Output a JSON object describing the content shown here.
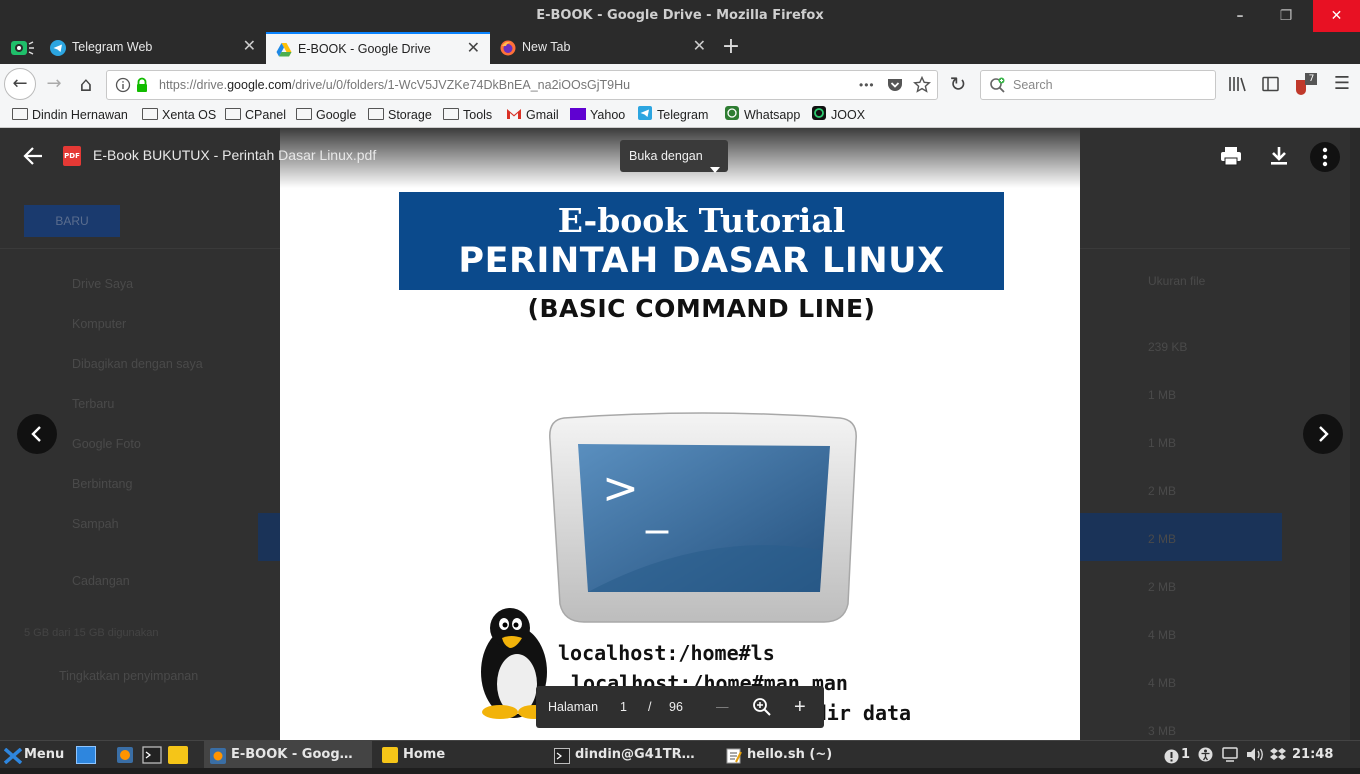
{
  "window": {
    "title": "E-BOOK - Google Drive - Mozilla Firefox",
    "minimize": "–",
    "maximize": "❐",
    "close": "✕"
  },
  "tabs": [
    {
      "label": "Telegram Web",
      "icon": "telegram-icon"
    },
    {
      "label": "E-BOOK - Google Drive",
      "icon": "google-drive-icon",
      "active": true
    },
    {
      "label": "New Tab",
      "icon": "firefox-icon"
    }
  ],
  "tab_close": "✕",
  "new_tab": "+",
  "nav": {
    "back": "←",
    "forward": "→",
    "home": "⌂",
    "url_prefix": "https://drive.",
    "url_domain": "google.com",
    "url_suffix": "/drive/u/0/folders/1-WcV5JVZKe74DkBnEA_na2iOOsGjT9Hu",
    "page_actions": "•••",
    "reload": "↻",
    "search_placeholder": "Search",
    "menu": "☰",
    "addon_badge": "7"
  },
  "bookmarks": [
    {
      "label": "Dindin Hernawan",
      "icon": "folder-icon"
    },
    {
      "label": "Xenta OS",
      "icon": "folder-icon"
    },
    {
      "label": "CPanel",
      "icon": "folder-icon"
    },
    {
      "label": "Google",
      "icon": "folder-icon"
    },
    {
      "label": "Storage",
      "icon": "folder-icon"
    },
    {
      "label": "Tools",
      "icon": "folder-icon"
    },
    {
      "label": "Gmail",
      "icon": "gmail-icon"
    },
    {
      "label": "Yahoo",
      "icon": "yahoo-icon"
    },
    {
      "label": "Telegram",
      "icon": "telegram-icon"
    },
    {
      "label": "Whatsapp",
      "icon": "whatsapp-icon"
    },
    {
      "label": "JOOX",
      "icon": "joox-icon"
    }
  ],
  "drive": {
    "new_button": "BARU",
    "sidebar": [
      "Drive Saya",
      "Komputer",
      "Dibagikan dengan saya",
      "Terbaru",
      "Google Foto",
      "Berbintang",
      "Sampah",
      "Cadangan"
    ],
    "storage_text": "5 GB dari 15 GB digunakan",
    "upgrade": "Tingkatkan penyimpanan",
    "size_header": "Ukuran file",
    "sizes": [
      "239 KB",
      "1 MB",
      "1 MB",
      "2 MB",
      "2 MB",
      "2 MB",
      "4 MB",
      "4 MB",
      "3 MB"
    ]
  },
  "viewer": {
    "file_name": "E-Book BUKUTUX - Perintah Dasar Linux.pdf",
    "file_badge": "PDF",
    "open_with": "Buka dengan",
    "page_label": "Halaman",
    "current_page": "1",
    "page_sep": "/",
    "total_pages": "96",
    "zoom_out": "—",
    "zoom_in": "+"
  },
  "pdf": {
    "title_line1": "E-book Tutorial",
    "title_line2": "PERINTAH DASAR LINUX",
    "subtitle": "(BASIC COMMAND LINE)",
    "prompt": ">",
    "cursor": "_",
    "terminal_lines": [
      "localhost:/home#ls",
      "localhost:/home#man man",
      "localhost:/home#mkdir data"
    ]
  },
  "taskbar": {
    "menu": "Menu",
    "windows": [
      {
        "label": "E-BOOK - Goog…",
        "active": true
      },
      {
        "label": "Home"
      },
      {
        "label": "dindin@G41TR…"
      },
      {
        "label": "hello.sh (~)"
      }
    ],
    "notification_count": "1",
    "clock": "21:48"
  },
  "colors": {
    "accent": "#0a84ff",
    "pdf_banner": "#0b4a8c",
    "close_button": "#e81123"
  }
}
